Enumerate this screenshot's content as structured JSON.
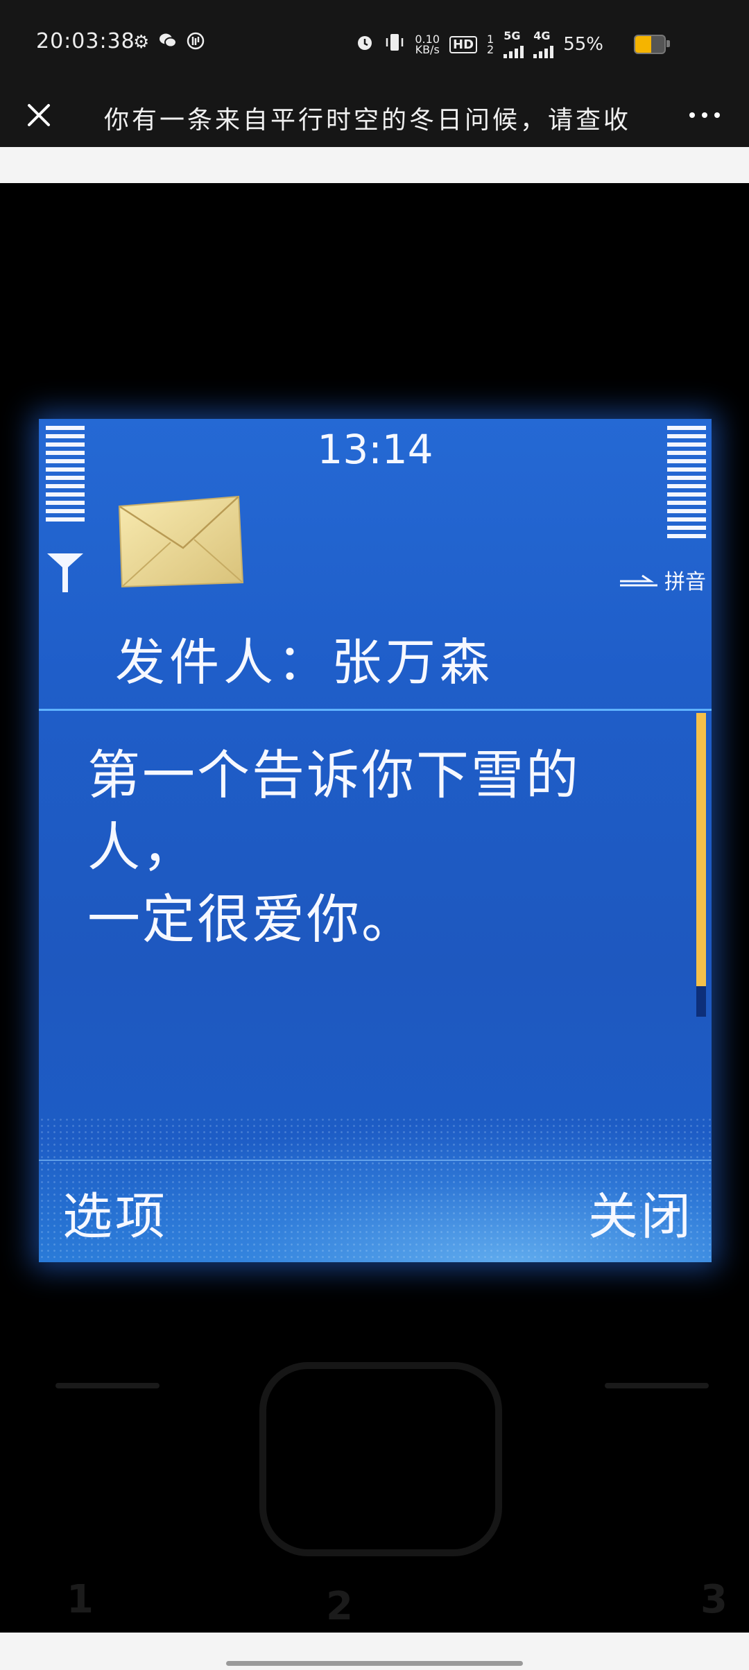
{
  "status_bar": {
    "time": "20:03:38",
    "net_speed_value": "0.10",
    "net_speed_unit": "KB/s",
    "hd_label": "HD",
    "hd_sub1": "1",
    "hd_sub2": "2",
    "net_5g": "5G",
    "net_4g": "4G",
    "battery_percent": "55%",
    "battery_level": 0.55,
    "battery_color": "#f5b400",
    "icons": [
      "gear-icon",
      "wechat-icon",
      "app-badge-icon",
      "alarm-icon",
      "vibrate-icon",
      "signal-icon"
    ]
  },
  "title_bar": {
    "title": "你有一条来自平行时空的冬日问候，请查收",
    "close_icon": "close-icon",
    "more_icon": "more-dots-icon"
  },
  "phone_screen": {
    "clock": "13:14",
    "input_mode": "拼音",
    "sender": "发件人：张万森",
    "message_line1": "第一个告诉你下雪的人，",
    "message_line2": "一定很爱你。",
    "scroll_position": 0.9,
    "scrollbar_color": "#f5c04a",
    "left_softkey": "选项",
    "right_softkey": "关闭",
    "screen_color": "#2569d4",
    "icons": [
      "signal-bars-icon",
      "battery-bars-icon",
      "antenna-icon",
      "envelope-icon",
      "arrow-icon"
    ]
  },
  "phone_keys": {
    "digit_1": "1",
    "digit_2": "2",
    "digit_3": "3"
  }
}
